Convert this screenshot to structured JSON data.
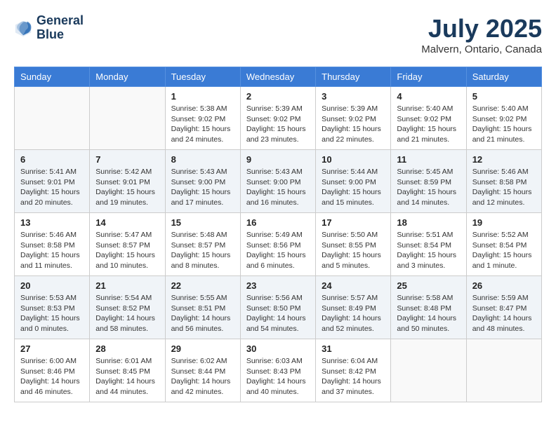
{
  "header": {
    "logo_line1": "General",
    "logo_line2": "Blue",
    "month": "July 2025",
    "location": "Malvern, Ontario, Canada"
  },
  "days_of_week": [
    "Sunday",
    "Monday",
    "Tuesday",
    "Wednesday",
    "Thursday",
    "Friday",
    "Saturday"
  ],
  "weeks": [
    [
      {
        "day": null
      },
      {
        "day": null
      },
      {
        "day": "1",
        "sunrise": "Sunrise: 5:38 AM",
        "sunset": "Sunset: 9:02 PM",
        "daylight": "Daylight: 15 hours and 24 minutes."
      },
      {
        "day": "2",
        "sunrise": "Sunrise: 5:39 AM",
        "sunset": "Sunset: 9:02 PM",
        "daylight": "Daylight: 15 hours and 23 minutes."
      },
      {
        "day": "3",
        "sunrise": "Sunrise: 5:39 AM",
        "sunset": "Sunset: 9:02 PM",
        "daylight": "Daylight: 15 hours and 22 minutes."
      },
      {
        "day": "4",
        "sunrise": "Sunrise: 5:40 AM",
        "sunset": "Sunset: 9:02 PM",
        "daylight": "Daylight: 15 hours and 21 minutes."
      },
      {
        "day": "5",
        "sunrise": "Sunrise: 5:40 AM",
        "sunset": "Sunset: 9:02 PM",
        "daylight": "Daylight: 15 hours and 21 minutes."
      }
    ],
    [
      {
        "day": "6",
        "sunrise": "Sunrise: 5:41 AM",
        "sunset": "Sunset: 9:01 PM",
        "daylight": "Daylight: 15 hours and 20 minutes."
      },
      {
        "day": "7",
        "sunrise": "Sunrise: 5:42 AM",
        "sunset": "Sunset: 9:01 PM",
        "daylight": "Daylight: 15 hours and 19 minutes."
      },
      {
        "day": "8",
        "sunrise": "Sunrise: 5:43 AM",
        "sunset": "Sunset: 9:00 PM",
        "daylight": "Daylight: 15 hours and 17 minutes."
      },
      {
        "day": "9",
        "sunrise": "Sunrise: 5:43 AM",
        "sunset": "Sunset: 9:00 PM",
        "daylight": "Daylight: 15 hours and 16 minutes."
      },
      {
        "day": "10",
        "sunrise": "Sunrise: 5:44 AM",
        "sunset": "Sunset: 9:00 PM",
        "daylight": "Daylight: 15 hours and 15 minutes."
      },
      {
        "day": "11",
        "sunrise": "Sunrise: 5:45 AM",
        "sunset": "Sunset: 8:59 PM",
        "daylight": "Daylight: 15 hours and 14 minutes."
      },
      {
        "day": "12",
        "sunrise": "Sunrise: 5:46 AM",
        "sunset": "Sunset: 8:58 PM",
        "daylight": "Daylight: 15 hours and 12 minutes."
      }
    ],
    [
      {
        "day": "13",
        "sunrise": "Sunrise: 5:46 AM",
        "sunset": "Sunset: 8:58 PM",
        "daylight": "Daylight: 15 hours and 11 minutes."
      },
      {
        "day": "14",
        "sunrise": "Sunrise: 5:47 AM",
        "sunset": "Sunset: 8:57 PM",
        "daylight": "Daylight: 15 hours and 10 minutes."
      },
      {
        "day": "15",
        "sunrise": "Sunrise: 5:48 AM",
        "sunset": "Sunset: 8:57 PM",
        "daylight": "Daylight: 15 hours and 8 minutes."
      },
      {
        "day": "16",
        "sunrise": "Sunrise: 5:49 AM",
        "sunset": "Sunset: 8:56 PM",
        "daylight": "Daylight: 15 hours and 6 minutes."
      },
      {
        "day": "17",
        "sunrise": "Sunrise: 5:50 AM",
        "sunset": "Sunset: 8:55 PM",
        "daylight": "Daylight: 15 hours and 5 minutes."
      },
      {
        "day": "18",
        "sunrise": "Sunrise: 5:51 AM",
        "sunset": "Sunset: 8:54 PM",
        "daylight": "Daylight: 15 hours and 3 minutes."
      },
      {
        "day": "19",
        "sunrise": "Sunrise: 5:52 AM",
        "sunset": "Sunset: 8:54 PM",
        "daylight": "Daylight: 15 hours and 1 minute."
      }
    ],
    [
      {
        "day": "20",
        "sunrise": "Sunrise: 5:53 AM",
        "sunset": "Sunset: 8:53 PM",
        "daylight": "Daylight: 15 hours and 0 minutes."
      },
      {
        "day": "21",
        "sunrise": "Sunrise: 5:54 AM",
        "sunset": "Sunset: 8:52 PM",
        "daylight": "Daylight: 14 hours and 58 minutes."
      },
      {
        "day": "22",
        "sunrise": "Sunrise: 5:55 AM",
        "sunset": "Sunset: 8:51 PM",
        "daylight": "Daylight: 14 hours and 56 minutes."
      },
      {
        "day": "23",
        "sunrise": "Sunrise: 5:56 AM",
        "sunset": "Sunset: 8:50 PM",
        "daylight": "Daylight: 14 hours and 54 minutes."
      },
      {
        "day": "24",
        "sunrise": "Sunrise: 5:57 AM",
        "sunset": "Sunset: 8:49 PM",
        "daylight": "Daylight: 14 hours and 52 minutes."
      },
      {
        "day": "25",
        "sunrise": "Sunrise: 5:58 AM",
        "sunset": "Sunset: 8:48 PM",
        "daylight": "Daylight: 14 hours and 50 minutes."
      },
      {
        "day": "26",
        "sunrise": "Sunrise: 5:59 AM",
        "sunset": "Sunset: 8:47 PM",
        "daylight": "Daylight: 14 hours and 48 minutes."
      }
    ],
    [
      {
        "day": "27",
        "sunrise": "Sunrise: 6:00 AM",
        "sunset": "Sunset: 8:46 PM",
        "daylight": "Daylight: 14 hours and 46 minutes."
      },
      {
        "day": "28",
        "sunrise": "Sunrise: 6:01 AM",
        "sunset": "Sunset: 8:45 PM",
        "daylight": "Daylight: 14 hours and 44 minutes."
      },
      {
        "day": "29",
        "sunrise": "Sunrise: 6:02 AM",
        "sunset": "Sunset: 8:44 PM",
        "daylight": "Daylight: 14 hours and 42 minutes."
      },
      {
        "day": "30",
        "sunrise": "Sunrise: 6:03 AM",
        "sunset": "Sunset: 8:43 PM",
        "daylight": "Daylight: 14 hours and 40 minutes."
      },
      {
        "day": "31",
        "sunrise": "Sunrise: 6:04 AM",
        "sunset": "Sunset: 8:42 PM",
        "daylight": "Daylight: 14 hours and 37 minutes."
      },
      {
        "day": null
      },
      {
        "day": null
      }
    ]
  ]
}
